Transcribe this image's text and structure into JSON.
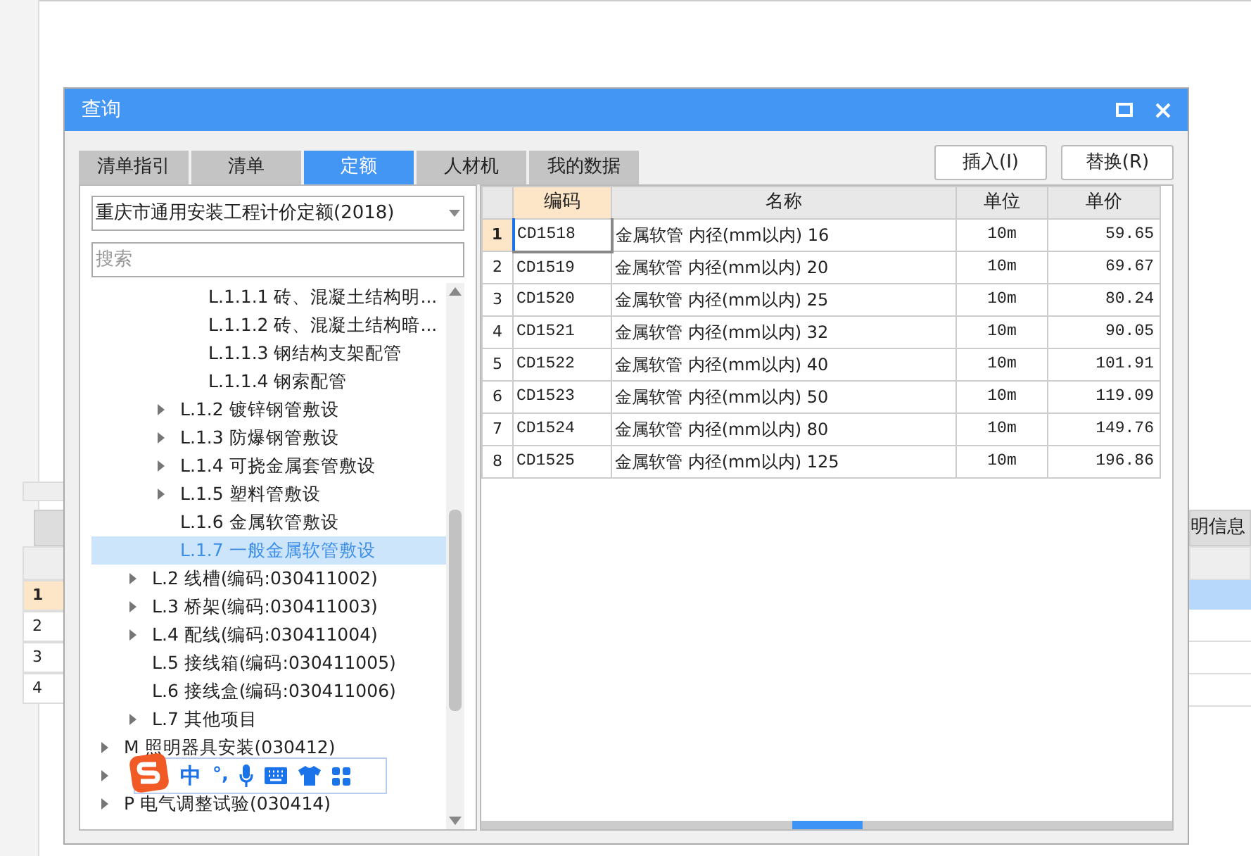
{
  "background_app": {
    "tab": "明信息",
    "row_numbers": [
      "1",
      "2",
      "3",
      "4"
    ]
  },
  "dialog": {
    "title": "查询",
    "tabs": [
      {
        "label": "清单指引",
        "selected": false
      },
      {
        "label": "清单",
        "selected": false
      },
      {
        "label": "定额",
        "selected": true
      },
      {
        "label": "人材机",
        "selected": false
      },
      {
        "label": "我的数据",
        "selected": false
      }
    ],
    "buttons": [
      "插入(I)",
      "替换(R)"
    ],
    "library_dropdown": {
      "value": "重庆市通用安装工程计价定额(2018)"
    },
    "search": {
      "placeholder": "搜索"
    },
    "tree": [
      {
        "children": [
          {
            "children": [
              {
                "children": [
                  {
                    "label": "L.1.1.1 砖、混凝土结构明...",
                    "expandable": false,
                    "selected": false
                  },
                  {
                    "label": "L.1.1.2 砖、混凝土结构暗...",
                    "expandable": false,
                    "selected": false
                  },
                  {
                    "label": "L.1.1.3 钢结构支架配管",
                    "expandable": false,
                    "selected": false
                  },
                  {
                    "label": "L.1.1.4 钢索配管",
                    "expandable": false,
                    "selected": false
                  }
                ]
              },
              {
                "label": "L.1.2 镀锌钢管敷设",
                "expandable": true,
                "selected": false
              },
              {
                "label": "L.1.3 防爆钢管敷设",
                "expandable": true,
                "selected": false
              },
              {
                "label": "L.1.4 可挠金属套管敷设",
                "expandable": true,
                "selected": false
              },
              {
                "label": "L.1.5 塑料管敷设",
                "expandable": true,
                "selected": false
              },
              {
                "label": "L.1.6 金属软管敷设",
                "expandable": false,
                "selected": false
              },
              {
                "label": "L.1.7 一般金属软管敷设",
                "expandable": false,
                "selected": true
              }
            ]
          },
          {
            "label": "L.2 线槽(编码:030411002)",
            "expandable": true,
            "selected": false
          },
          {
            "label": "L.3 桥架(编码:030411003)",
            "expandable": true,
            "selected": false
          },
          {
            "label": "L.4 配线(编码:030411004)",
            "expandable": true,
            "selected": false
          },
          {
            "label": "L.5 接线箱(编码:030411005)",
            "expandable": false,
            "selected": false
          },
          {
            "label": "L.6 接线盒(编码:030411006)",
            "expandable": false,
            "selected": false
          },
          {
            "label": "L.7 其他项目",
            "expandable": true,
            "selected": false
          }
        ]
      },
      {
        "label": "M 照明器具安装(030412)",
        "expandable": true,
        "selected": false
      },
      {
        "expandable": true
      },
      {
        "label": "P 电气调整试验(030414)",
        "expandable": true,
        "selected": false
      }
    ],
    "table": {
      "columns": [
        "编码",
        "名称",
        "单位",
        "单价"
      ],
      "rows": [
        {
          "number": "1",
          "cells": [
            "CD1518",
            "金属软管 内径(mm以内) 16",
            "10m",
            "59.65"
          ],
          "selected": true
        },
        {
          "number": "2",
          "cells": [
            "CD1519",
            "金属软管 内径(mm以内) 20",
            "10m",
            "69.67"
          ],
          "selected": false
        },
        {
          "number": "3",
          "cells": [
            "CD1520",
            "金属软管 内径(mm以内) 25",
            "10m",
            "80.24"
          ],
          "selected": false
        },
        {
          "number": "4",
          "cells": [
            "CD1521",
            "金属软管 内径(mm以内) 32",
            "10m",
            "90.05"
          ],
          "selected": false
        },
        {
          "number": "5",
          "cells": [
            "CD1522",
            "金属软管 内径(mm以内) 40",
            "10m",
            "101.91"
          ],
          "selected": false
        },
        {
          "number": "6",
          "cells": [
            "CD1523",
            "金属软管 内径(mm以内) 50",
            "10m",
            "119.09"
          ],
          "selected": false
        },
        {
          "number": "7",
          "cells": [
            "CD1524",
            "金属软管 内径(mm以内) 80",
            "10m",
            "149.76"
          ],
          "selected": false
        },
        {
          "number": "8",
          "cells": [
            "CD1525",
            "金属软管 内径(mm以内) 125",
            "10m",
            "196.86"
          ],
          "selected": false
        }
      ]
    }
  },
  "ime_toolbar": {
    "mode": "中",
    "punctuation": "°,"
  }
}
